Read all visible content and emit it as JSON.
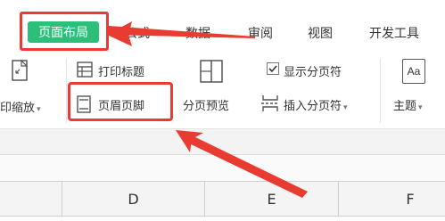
{
  "tabs": {
    "active": "页面布局",
    "formulas": "公式",
    "data": "数据",
    "review": "审阅",
    "view": "视图",
    "developer": "开发工具"
  },
  "ribbon": {
    "print_scaling": "印缩放",
    "print_titles": "打印标题",
    "header_footer": "页眉页脚",
    "page_break_preview": "分页预览",
    "show_page_breaks": "显示分页符",
    "insert_page_break": "插入分页符",
    "theme": "主题",
    "theme_icon_text": "Aa"
  },
  "columns": [
    "D",
    "E",
    "F"
  ],
  "colors": {
    "active_tab": "#2bbf7a",
    "highlight": "#e83b31"
  },
  "icons": [
    "print-scaling-icon",
    "print-titles-icon",
    "header-footer-icon",
    "page-break-preview-icon",
    "checkbox-checked-icon",
    "insert-page-break-icon",
    "theme-icon"
  ]
}
